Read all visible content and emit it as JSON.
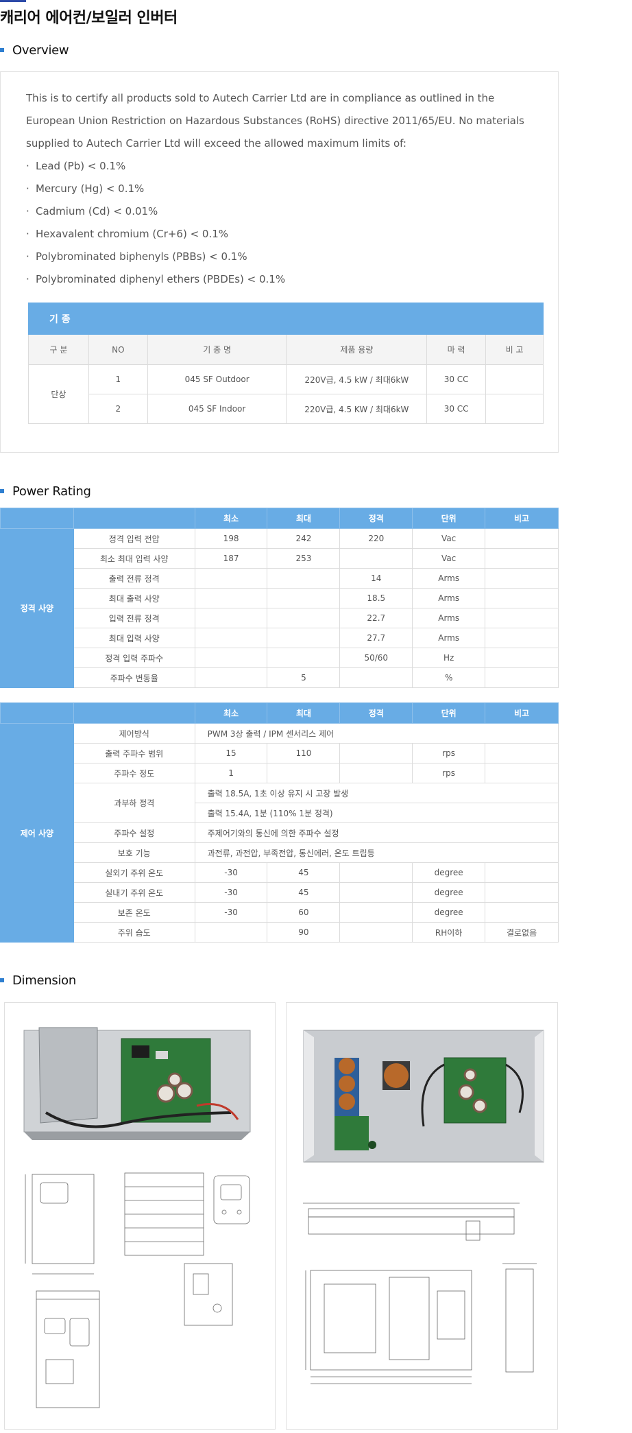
{
  "page": {
    "title": "캐리어 에어컨/보일러 인버터"
  },
  "sections": {
    "overview": "Overview",
    "power_rating": "Power Rating",
    "dimension": "Dimension"
  },
  "overview": {
    "para": [
      "This is to certify all products sold to Autech Carrier Ltd are in compliance as outlined in the",
      "European Union Restriction on Hazardous Substances (RoHS) directive 2011/65/EU. No materials",
      "supplied to Autech Carrier Ltd will exceed the allowed maximum limits of:"
    ],
    "limits": [
      "Lead (Pb) < 0.1%",
      "Mercury (Hg) < 0.1%",
      "Cadmium (Cd) < 0.01%",
      "Hexavalent chromium (Cr+6) < 0.1%",
      "Polybrominated biphenyls (PBBs) < 0.1%",
      "Polybrominated diphenyl ethers (PBDEs) < 0.1%"
    ],
    "bullet": "·"
  },
  "models": {
    "caption": "기 종",
    "headers": [
      "구 분",
      "NO",
      "기 종 명",
      "제품 용량",
      "마 력",
      "비 고"
    ],
    "group": "단상",
    "rows": [
      {
        "no": "1",
        "name": "045 SF Outdoor",
        "capacity": "220V급, 4.5 kW / 최대6kW",
        "hp": "30 CC",
        "note": ""
      },
      {
        "no": "2",
        "name": "045 SF Indoor",
        "capacity": "220V급, 4.5 KW / 최대6kW",
        "hp": "30 CC",
        "note": ""
      }
    ]
  },
  "power": {
    "headers": [
      "최소",
      "최대",
      "정격",
      "단위",
      "비고"
    ],
    "group": "정격 사양",
    "rows": [
      {
        "label": "정격 입력 전압",
        "min": "198",
        "max": "242",
        "rated": "220",
        "unit": "Vac",
        "note": ""
      },
      {
        "label": "최소 최대 입력 사양",
        "min": "187",
        "max": "253",
        "rated": "",
        "unit": "Vac",
        "note": ""
      },
      {
        "label": "출력 전류 정격",
        "min": "",
        "max": "",
        "rated": "14",
        "unit": "Arms",
        "note": ""
      },
      {
        "label": "최대 출력 사양",
        "min": "",
        "max": "",
        "rated": "18.5",
        "unit": "Arms",
        "note": ""
      },
      {
        "label": "입력 전류 정격",
        "min": "",
        "max": "",
        "rated": "22.7",
        "unit": "Arms",
        "note": ""
      },
      {
        "label": "최대 입력 사양",
        "min": "",
        "max": "",
        "rated": "27.7",
        "unit": "Arms",
        "note": ""
      },
      {
        "label": "정격 입력 주파수",
        "min": "",
        "max": "",
        "rated": "50/60",
        "unit": "Hz",
        "note": ""
      },
      {
        "label": "주파수 변동율",
        "min": "",
        "max": "5",
        "rated": "",
        "unit": "%",
        "note": ""
      }
    ]
  },
  "control": {
    "headers": [
      "최소",
      "최대",
      "정격",
      "단위",
      "비고"
    ],
    "group": "제어 사양",
    "method_label": "제어방식",
    "method_value": "PWM 3상 출력 / IPM 센서리스 제어",
    "freq_range": {
      "label": "출력 주파수 범위",
      "min": "15",
      "max": "110",
      "unit": "rps"
    },
    "freq_acc": {
      "label": "주파수 정도",
      "min": "1",
      "unit": "rps"
    },
    "overload_label": "과부하 정격",
    "overload_1": "출력 18.5A,  1초 이상 유지 시 고장 발생",
    "overload_2": "출력 15.4A,  1분 (110% 1분 정격)",
    "freq_set_label": "주파수 설정",
    "freq_set_value": "주제어기와의 통신에 의한 주파수 설정",
    "protect_label": "보호 기능",
    "protect_value": "과전류, 과전압, 부족전압, 통신에러, 온도 트립등",
    "temps": [
      {
        "label": "실외기 주위 온도",
        "min": "-30",
        "max": "45",
        "unit": "degree",
        "note": ""
      },
      {
        "label": "실내기 주위 온도",
        "min": "-30",
        "max": "45",
        "unit": "degree",
        "note": ""
      },
      {
        "label": "보존 온도",
        "min": "-30",
        "max": "60",
        "unit": "degree",
        "note": ""
      }
    ],
    "humidity": {
      "label": "주위 습도",
      "max": "90",
      "unit": "RH이하",
      "note": "결로없음"
    }
  },
  "colors": {
    "accent": "#68ace5",
    "bullet": "#2f7fd0",
    "pcb": "#2f7a3a",
    "metal": "#c7cacd"
  }
}
